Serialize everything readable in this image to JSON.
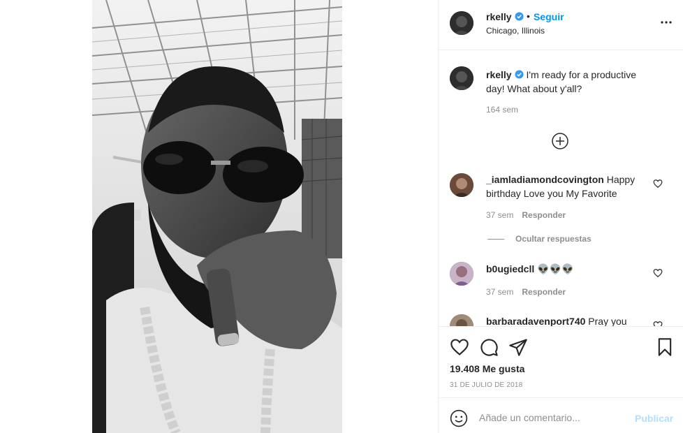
{
  "colors": {
    "accent": "#0095f6",
    "publish_disabled": "#b2dffc",
    "text_primary": "#262626",
    "text_secondary": "#8e8e8e",
    "verified_badge": "#3897f0"
  },
  "post": {
    "image_alt": "Foto en blanco y negro de un hombre con gafas de sol y un puro"
  },
  "header": {
    "username": "rkelly",
    "dot": "•",
    "follow_label": "Seguir",
    "location": "Chicago, Illinois",
    "more_icon": "more-options-icon"
  },
  "caption": {
    "username": "rkelly",
    "text": "I'm ready for a productive day! What about y'all?",
    "time": "164 sem"
  },
  "comments": [
    {
      "username": "_iamladiamondcovington",
      "text": "Happy birthday Love you My Favorite",
      "time": "37 sem",
      "reply_label": "Responder"
    },
    {
      "username": "b0ugiedcll",
      "text": "👽👽👽",
      "time": "37 sem",
      "reply_label": "Responder"
    },
    {
      "username": "barbaradavenport740",
      "text": "Pray you"
    }
  ],
  "hide_replies_label": "Ocultar respuestas",
  "actions": {
    "likes": "19.408 Me gusta",
    "date": "31 DE JULIO DE 2018"
  },
  "add_comment": {
    "placeholder": "Añade un comentario...",
    "publish_label": "Publicar"
  }
}
